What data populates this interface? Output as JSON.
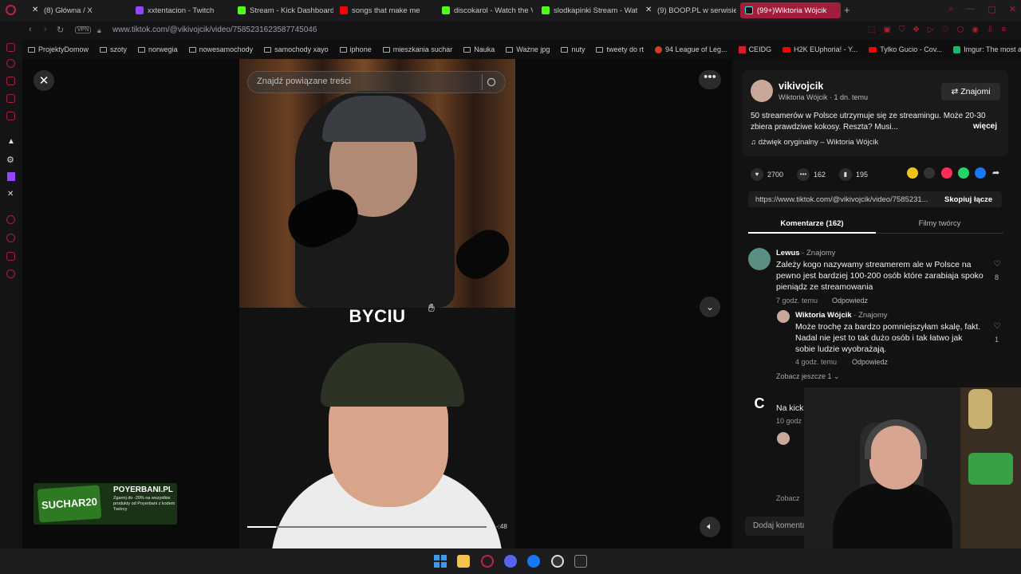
{
  "browser": {
    "tabs": [
      {
        "label": "(8) Główna / X",
        "color": "#dddddd"
      },
      {
        "label": "xxtentacion - Twitch",
        "color": "#9146ff"
      },
      {
        "label": "Stream - Kick Dashboard",
        "color": "#53fc18"
      },
      {
        "label": "songs that make me",
        "color": "#ff0000"
      },
      {
        "label": "discokarol - Watch the VC",
        "color": "#53fc18"
      },
      {
        "label": "slodkapinki Stream - Wat",
        "color": "#53fc18"
      },
      {
        "label": "(9) BOOP.PL w serwisie",
        "color": "#dddddd"
      },
      {
        "label": "(99+)Wiktoria Wójcik",
        "color": "#25f4ee"
      }
    ],
    "url": "www.tiktok.com/@vikivojcik/video/7585231623587745046",
    "vpn_label": "VPN",
    "bookmarks": [
      {
        "label": "ProjektyDomow",
        "icon": "folder"
      },
      {
        "label": "szoty",
        "icon": "folder"
      },
      {
        "label": "norwegia",
        "icon": "folder"
      },
      {
        "label": "nowesamochody",
        "icon": "folder"
      },
      {
        "label": "samochody xayo",
        "icon": "folder"
      },
      {
        "label": "iphone",
        "icon": "folder"
      },
      {
        "label": "mieszkania suchar",
        "icon": "folder"
      },
      {
        "label": "Nauka",
        "icon": "folder"
      },
      {
        "label": "Ważne jpg",
        "icon": "folder"
      },
      {
        "label": "nuty",
        "icon": "folder"
      },
      {
        "label": "tweety do rt",
        "icon": "folder"
      },
      {
        "label": "94 League of Leg...",
        "icon": "site"
      },
      {
        "label": "CEIDG",
        "icon": "site"
      },
      {
        "label": "H2K EUphoria! - Y...",
        "icon": "site"
      },
      {
        "label": "Tylko Gucio - Cov...",
        "icon": "site"
      },
      {
        "label": "Imgur: The most a...",
        "icon": "site"
      }
    ]
  },
  "video": {
    "search_placeholder": "Znajdź powiązane treści",
    "caption": "BYCIU",
    "time_remaining": "-:48",
    "progress": 0.12
  },
  "ad": {
    "code_label": "SUCHAR20",
    "brand": "POYERBANI.PL",
    "description": "Zgarnij do -20% na wszystkie produkty od Poyerbani z kodem Twórcy"
  },
  "author": {
    "username": "vikivojcik",
    "display_name": "Wiktoria Wójcik",
    "posted": "1 dn. temu",
    "follow_label": "Znajomi",
    "description": "50 streamerów w Polsce utrzymuje się ze streamingu. Może 20-30 zbiera prawdziwe kokosy. Reszta? Musi...",
    "more_label": "więcej",
    "sound": "dźwięk oryginalny – Wiktoria Wójcik"
  },
  "stats": {
    "likes": "2700",
    "comments": "162",
    "saves": "195"
  },
  "link": {
    "url": "https://www.tiktok.com/@vikivojcik/video/7585231...",
    "copy_label": "Skopiuj łącze"
  },
  "panel_tabs": {
    "comments": "Komentarze (162)",
    "creator_videos": "Filmy twórcy"
  },
  "comments": [
    {
      "name": "Lewus",
      "tag": " · Znajomy",
      "text": "Zależy kogo nazywamy streamerem ale w Polsce na pewno jest bardziej 100-200 osób które zarabiaja spoko pieniądz ze streamowania",
      "time": "7 godz. temu",
      "reply_label": "Odpowiedz",
      "likes": "8"
    },
    {
      "name": "Wiktoria Wójcik",
      "tag": " · Znajomy",
      "text": "Może trochę za bardzo pomniejszyłam skalę, fakt. Nadal nie jest to tak dużo osób i tak łatwo jak sobie ludzie wyobrażają.",
      "time": "4 godz. temu",
      "reply_label": "Odpowiedz",
      "likes": "1"
    },
    {
      "name": "",
      "tag": "",
      "text": "Na kick",
      "time": "10 godz",
      "reply_label": "",
      "likes": ""
    }
  ],
  "view_more": "Zobacz jeszcze 1 ⌄",
  "view_more_2": "Zobacz",
  "add_comment_placeholder": "Dodaj komenta",
  "colors": {
    "accent_tab": "#a01e3c",
    "tiktok_bg": "#121212"
  }
}
